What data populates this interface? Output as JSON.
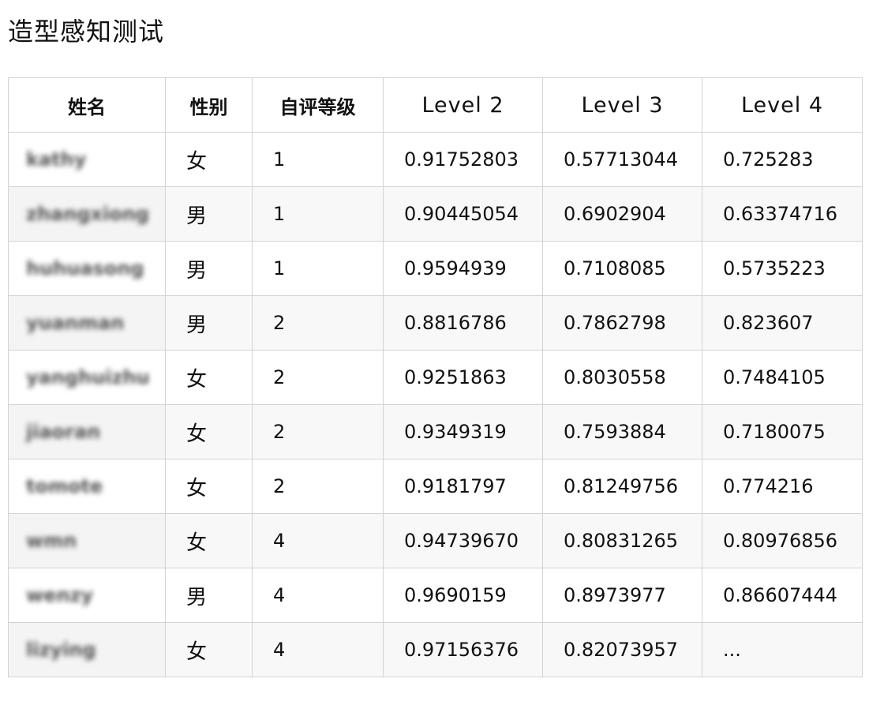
{
  "title": "造型感知测试",
  "table": {
    "headers": [
      "姓名",
      "性别",
      "自评等级",
      "Level 2",
      "Level 3",
      "Level 4"
    ],
    "rows": [
      {
        "name": "kathy",
        "gender": "女",
        "grade": "1",
        "level2": "0.91752803",
        "level3": "0.57713044",
        "level4": "0.725283"
      },
      {
        "name": "zhangxiong",
        "gender": "男",
        "grade": "1",
        "level2": "0.90445054",
        "level3": "0.6902904",
        "level4": "0.63374716"
      },
      {
        "name": "huhuasong",
        "gender": "男",
        "grade": "1",
        "level2": "0.9594939",
        "level3": "0.7108085",
        "level4": "0.5735223"
      },
      {
        "name": "yuanman",
        "gender": "男",
        "grade": "2",
        "level2": "0.8816786",
        "level3": "0.7862798",
        "level4": "0.823607"
      },
      {
        "name": "yanghuizhu",
        "gender": "女",
        "grade": "2",
        "level2": "0.9251863",
        "level3": "0.8030558",
        "level4": "0.7484105"
      },
      {
        "name": "jiaoran",
        "gender": "女",
        "grade": "2",
        "level2": "0.9349319",
        "level3": "0.7593884",
        "level4": "0.7180075"
      },
      {
        "name": "tomote",
        "gender": "女",
        "grade": "2",
        "level2": "0.9181797",
        "level3": "0.81249756",
        "level4": "0.774216"
      },
      {
        "name": "wmn",
        "gender": "女",
        "grade": "4",
        "level2": "0.94739670",
        "level3": "0.80831265",
        "level4": "0.80976856"
      },
      {
        "name": "wenzy",
        "gender": "男",
        "grade": "4",
        "level2": "0.9690159",
        "level3": "0.8973977",
        "level4": "0.86607444"
      },
      {
        "name": "lizying",
        "gender": "女",
        "grade": "4",
        "level2": "0.97156376",
        "level3": "0.82073957",
        "level4": "..."
      }
    ]
  }
}
